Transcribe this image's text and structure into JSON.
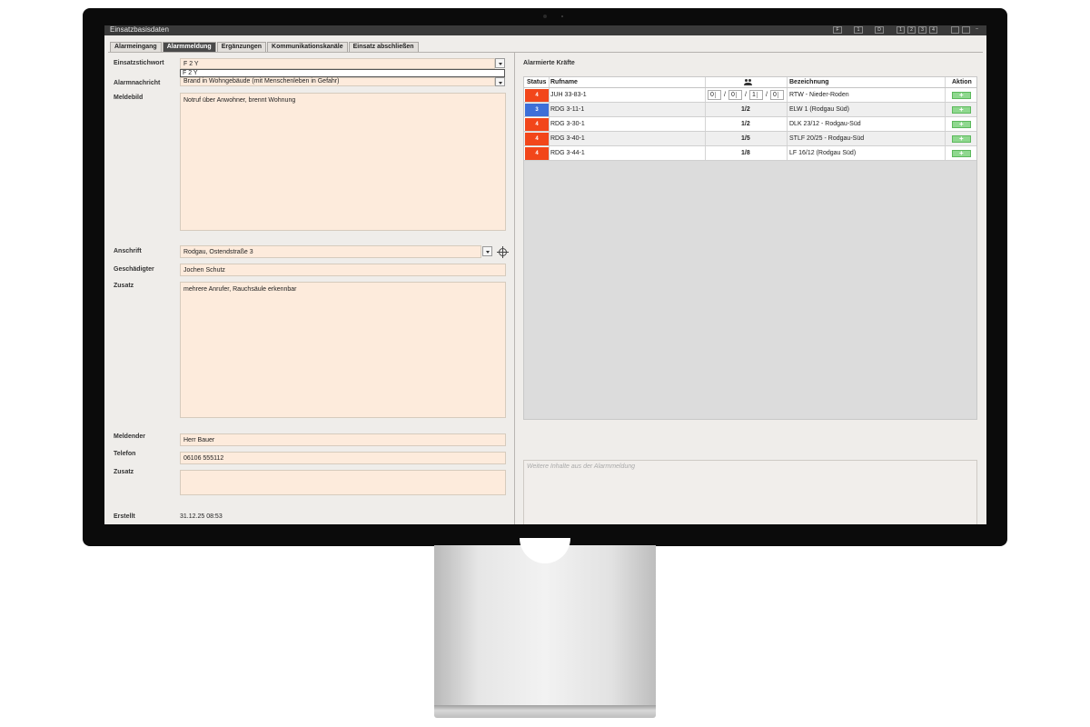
{
  "window": {
    "title": "Einsatzbasisdaten",
    "buttons": [
      "F",
      "1",
      "D",
      "1",
      "2",
      "3",
      "4"
    ]
  },
  "tabs": [
    {
      "label": "Alarmeingang",
      "active": false
    },
    {
      "label": "Alarmmeldung",
      "active": true
    },
    {
      "label": "Ergänzungen",
      "active": false
    },
    {
      "label": "Kommunikationskanäle",
      "active": false
    },
    {
      "label": "Einsatz abschließen",
      "active": false
    }
  ],
  "form": {
    "einsatzstichwort_label": "Einsatzstichwort",
    "einsatzstichwort_value": "F 2 Y",
    "einsatzstichwort_suggestion": "F 2 Y",
    "alarmnachricht_label": "Alarmnachricht",
    "alarmnachricht_value": "Brand in Wohngebäude (mit Menschenleben in Gefahr)",
    "meldebild_label": "Meldebild",
    "meldebild_value": "Notruf über Anwohner, brennt Wohnung",
    "anschrift_label": "Anschrift",
    "anschrift_value": "Rodgau, Ostendstraße 3",
    "geschaedigter_label": "Geschädigter",
    "geschaedigter_value": "Jochen Schutz",
    "zusatz_label": "Zusatz",
    "zusatz_value": "mehrere Anrufer, Rauchsäule erkennbar",
    "meldender_label": "Meldender",
    "meldender_value": "Herr Bauer",
    "telefon_label": "Telefon",
    "telefon_value": "06106 555112",
    "zusatz2_label": "Zusatz",
    "zusatz2_value": "",
    "erstellt_label": "Erstellt",
    "erstellt_value": "31.12.25 08:53"
  },
  "kraefte": {
    "heading": "Alarmierte Kräfte",
    "columns": {
      "status": "Status",
      "rufname": "Rufname",
      "bezeichnung": "Bezeichnung",
      "aktion": "Aktion"
    },
    "rows": [
      {
        "status": "4",
        "status_color": "#f2461a",
        "rufname": "JUH 33-83-1",
        "staerke": [
          "0",
          "0",
          "1",
          "0"
        ],
        "bezeichnung": "RTW - Nieder-Roden"
      },
      {
        "status": "3",
        "status_color": "#3d6fd8",
        "rufname": "RDG 3-11-1",
        "staerke_text": "1/2",
        "bezeichnung": "ELW 1 (Rodgau Süd)"
      },
      {
        "status": "4",
        "status_color": "#f2461a",
        "rufname": "RDG 3-30-1",
        "staerke_text": "1/2",
        "bezeichnung": "DLK 23/12 - Rodgau-Süd"
      },
      {
        "status": "4",
        "status_color": "#f2461a",
        "rufname": "RDG 3-40-1",
        "staerke_text": "1/5",
        "bezeichnung": "STLF 20/25 - Rodgau-Süd"
      },
      {
        "status": "4",
        "status_color": "#f2461a",
        "rufname": "RDG 3-44-1",
        "staerke_text": "1/8",
        "bezeichnung": "LF 16/12 (Rodgau Süd)"
      }
    ],
    "hint": "Weitere Inhalte aus der Alarmmeldung"
  }
}
